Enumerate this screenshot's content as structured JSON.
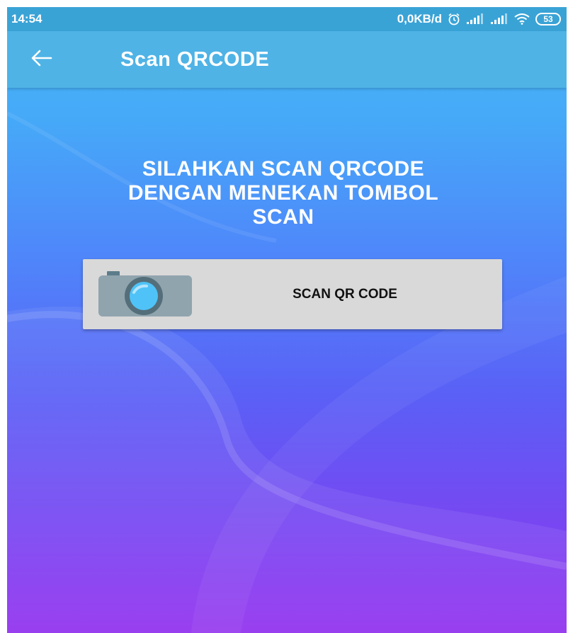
{
  "status_bar": {
    "time": "14:54",
    "network_speed": "0,0KB/d",
    "battery_level": "53",
    "icons": [
      "alarm-icon",
      "signal-icon",
      "signal-icon",
      "wifi-icon",
      "battery-icon"
    ]
  },
  "app_bar": {
    "back_icon": "arrow-left-icon",
    "title": "Scan QRCODE",
    "color": "#4fb3e6"
  },
  "main": {
    "instruction_lines": [
      "SILAHKAN SCAN QRCODE",
      "DENGAN MENEKAN TOMBOL",
      "SCAN"
    ],
    "scan_button": {
      "icon": "camera-icon",
      "label": "SCAN QR CODE"
    }
  },
  "colors": {
    "gradient_top": "#45b8f5",
    "gradient_bottom": "#9231ee",
    "button_bg": "#d9d9d9"
  }
}
